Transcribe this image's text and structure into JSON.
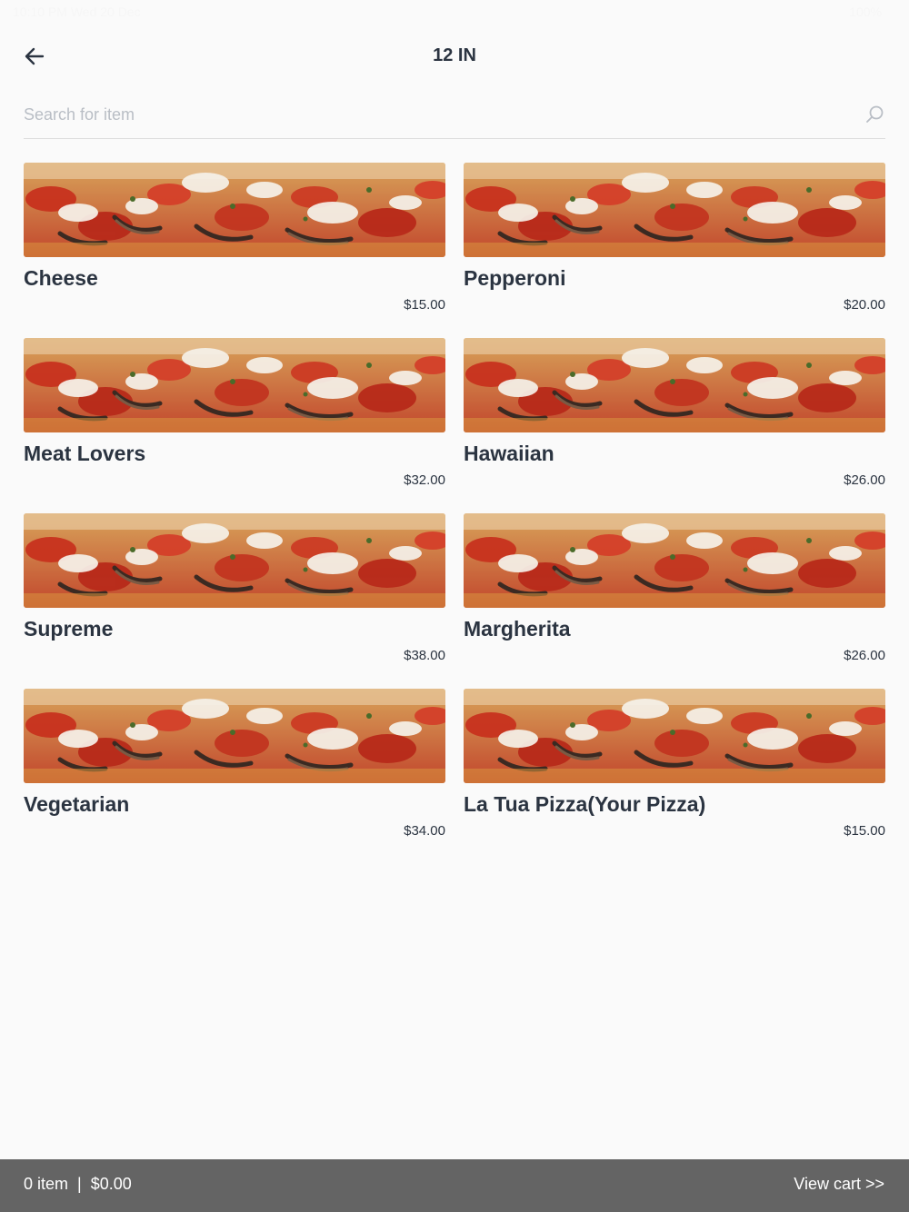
{
  "status_bar": {
    "time": "10:10 PM   Wed 20 Dec",
    "right": "100%"
  },
  "header": {
    "title": "12 IN"
  },
  "search": {
    "placeholder": "Search for item"
  },
  "items": [
    {
      "name": "Cheese",
      "price": "$15.00"
    },
    {
      "name": "Pepperoni",
      "price": "$20.00"
    },
    {
      "name": "Meat Lovers",
      "price": "$32.00"
    },
    {
      "name": "Hawaiian",
      "price": "$26.00"
    },
    {
      "name": "Supreme",
      "price": "$38.00"
    },
    {
      "name": "Margherita",
      "price": "$26.00"
    },
    {
      "name": "Vegetarian",
      "price": "$34.00"
    },
    {
      "name": "La Tua Pizza(Your Pizza)",
      "price": "$15.00"
    }
  ],
  "cart": {
    "count": "0 item",
    "separator": "|",
    "total": "$0.00",
    "view_label": "View cart >>"
  },
  "icons": {
    "back": "arrow-left-icon",
    "search": "search-icon"
  },
  "colors": {
    "text": "#2b3441",
    "cart_bar": "#646464",
    "background": "#fafafa"
  }
}
